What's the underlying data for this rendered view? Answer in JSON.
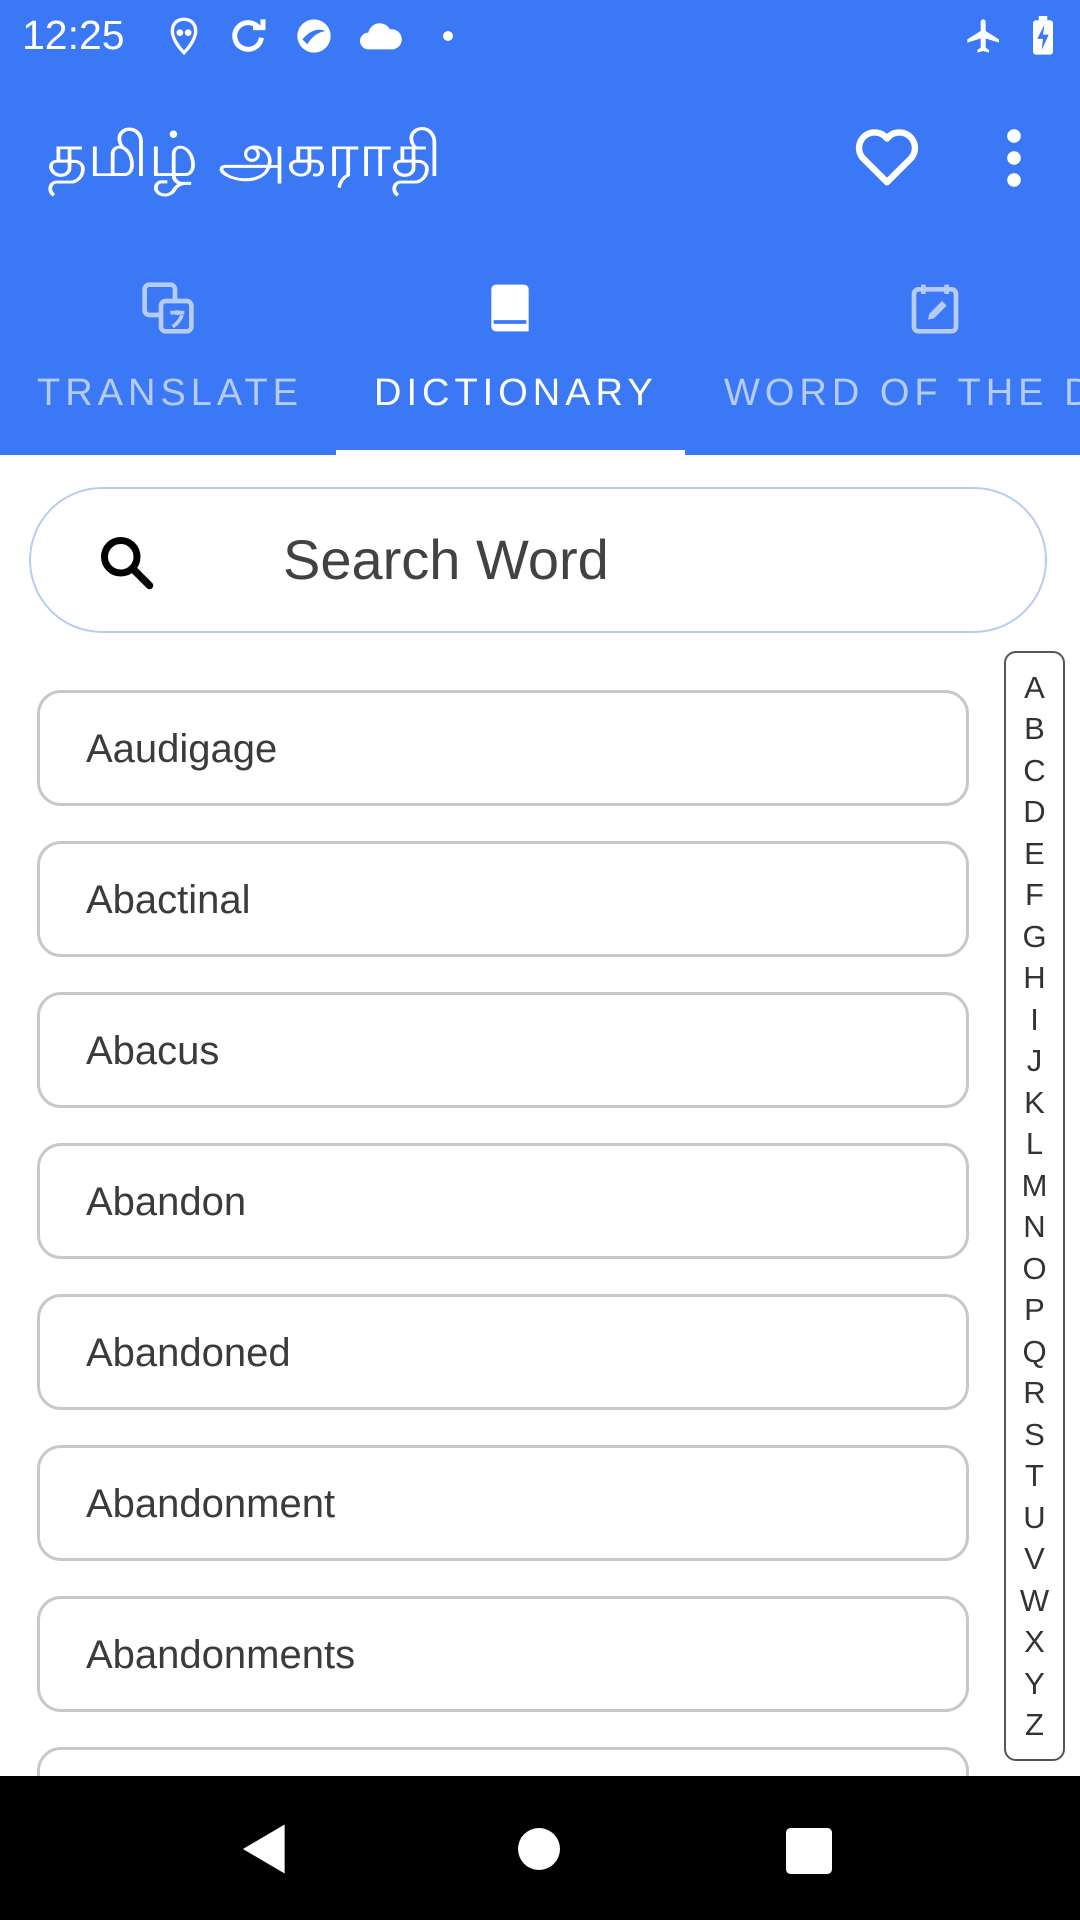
{
  "status_bar": {
    "time": "12:25",
    "icons": [
      "alien-notification-icon",
      "sync-icon",
      "vpn-app-icon",
      "cloud-icon",
      "dot-icon",
      "airplane-mode-icon",
      "battery-charging-icon"
    ]
  },
  "app_bar": {
    "title": "தமிழ் அகராதி",
    "favorite_icon": "heart-outline-icon",
    "more_icon": "more-vert-icon"
  },
  "tabs": [
    {
      "label": "TRANSLATE",
      "icon": "translate-icon",
      "active": false
    },
    {
      "label": "DICTIONARY",
      "icon": "book-icon",
      "active": true
    },
    {
      "label": "WORD OF THE D",
      "icon": "calendar-edit-icon",
      "active": false
    }
  ],
  "search": {
    "placeholder": "Search Word",
    "icon": "search-icon"
  },
  "words": [
    "Aaudigage",
    "Abactinal",
    "Abacus",
    "Abandon",
    "Abandoned",
    "Abandonment",
    "Abandonments",
    ""
  ],
  "alphabet": [
    "A",
    "B",
    "C",
    "D",
    "E",
    "F",
    "G",
    "H",
    "I",
    "J",
    "K",
    "L",
    "M",
    "N",
    "O",
    "P",
    "Q",
    "R",
    "S",
    "T",
    "U",
    "V",
    "W",
    "X",
    "Y",
    "Z"
  ],
  "nav_bar": {
    "back_icon": "back-triangle-icon",
    "home_icon": "home-circle-icon",
    "recents_icon": "recents-square-icon"
  },
  "colors": {
    "primary": "#3b78f5",
    "inactive_tab": "#b6ccf7",
    "search_border": "#b5cdf0",
    "item_border": "#c8c8c8"
  }
}
